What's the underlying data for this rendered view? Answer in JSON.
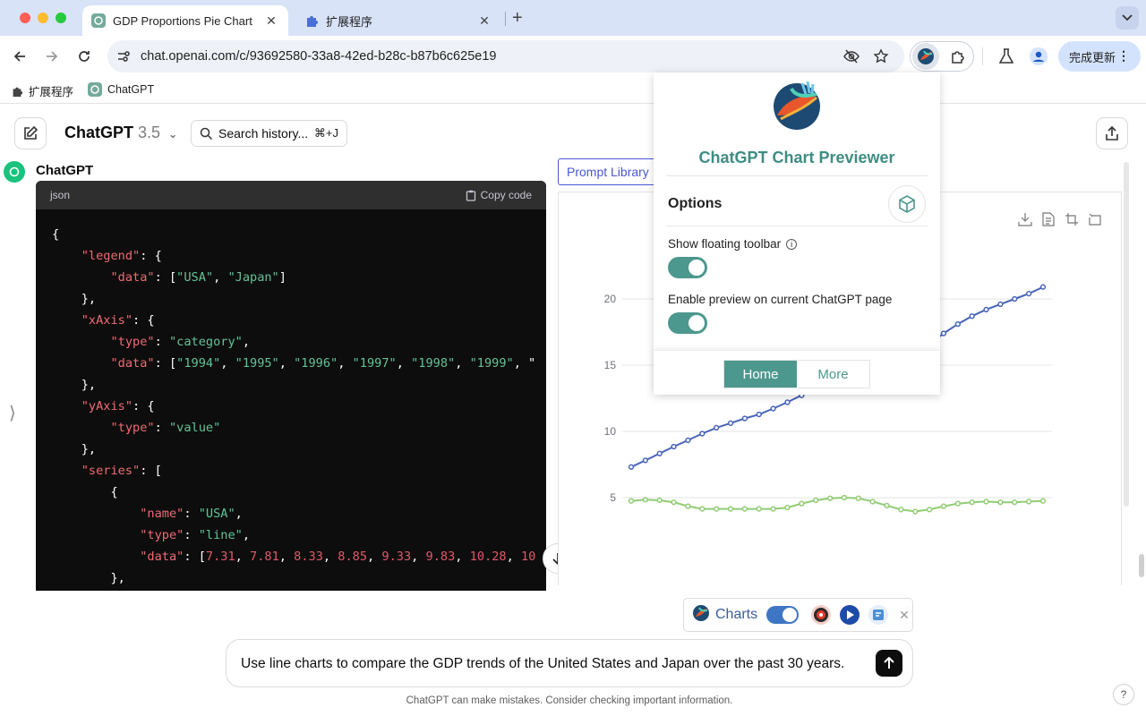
{
  "browser": {
    "tabs": [
      {
        "title": "GDP Proportions Pie Chart",
        "active": true
      },
      {
        "title": "扩展程序",
        "active": false
      }
    ],
    "url": "chat.openai.com/c/93692580-33a8-42ed-b28c-b87b6c625e19",
    "update_label": "完成更新",
    "bookmarks": [
      {
        "label": "扩展程序",
        "icon": "puzzle-icon"
      },
      {
        "label": "ChatGPT",
        "icon": "chatgpt-icon"
      }
    ]
  },
  "chat": {
    "model": "ChatGPT",
    "model_version": "3.5",
    "search_placeholder": "Search history...",
    "search_shortcut": "⌘+J",
    "bot_name": "ChatGPT",
    "code": {
      "lang": "json",
      "copy_label": "Copy code",
      "lines": [
        "{",
        "    \"legend\": {",
        "        \"data\": [\"USA\", \"Japan\"]",
        "    },",
        "    \"xAxis\": {",
        "        \"type\": \"category\",",
        "        \"data\": [\"1994\", \"1995\", \"1996\", \"1997\", \"1998\", \"1999\", \"",
        "    },",
        "    \"yAxis\": {",
        "        \"type\": \"value\"",
        "    },",
        "    \"series\": [",
        "        {",
        "            \"name\": \"USA\",",
        "            \"type\": \"line\",",
        "            \"data\": [7.31, 7.81, 8.33, 8.85, 9.33, 9.83, 10.28, 10",
        "        },"
      ]
    },
    "composer_text": "Use line charts to compare the GDP trends of the United States and Japan over the past 30 years.",
    "disclaimer": "ChatGPT can make mistakes. Consider checking important information.",
    "help": "?"
  },
  "preview": {
    "prompt_library": "Prompt Library",
    "floating_toolbar_label": "Charts"
  },
  "popup": {
    "title": "ChatGPT Chart Previewer",
    "options_heading": "Options",
    "option_1": "Show floating toolbar",
    "option_2": "Enable preview on current ChatGPT page",
    "option_1_on": true,
    "option_2_on": true,
    "tab_home": "Home",
    "tab_more": "More"
  },
  "chart_data": {
    "type": "line",
    "ylim": [
      0,
      25
    ],
    "yticks": [
      5,
      10,
      15,
      20,
      25
    ],
    "series": [
      {
        "name": "USA",
        "color": "#4964b8",
        "values": [
          7.31,
          7.81,
          8.33,
          8.85,
          9.33,
          9.83,
          10.28,
          10.62,
          10.98,
          11.28,
          11.72,
          12.2,
          12.72,
          13.25,
          13.45,
          13.3,
          14.2,
          14.6,
          15.0,
          15.5,
          16.0,
          16.6,
          17.4,
          18.1,
          18.7,
          19.2,
          19.6,
          20.0,
          20.4,
          20.9
        ]
      },
      {
        "name": "Japan",
        "color": "#91cc75",
        "values": [
          4.75,
          4.85,
          4.8,
          4.65,
          4.35,
          4.15,
          4.15,
          4.15,
          4.15,
          4.15,
          4.15,
          4.25,
          4.55,
          4.8,
          4.95,
          5.0,
          4.95,
          4.7,
          4.4,
          4.1,
          3.95,
          4.1,
          4.35,
          4.55,
          4.65,
          4.7,
          4.65,
          4.65,
          4.7,
          4.75
        ]
      }
    ]
  },
  "colors": {
    "accent": "#4d988e",
    "chart_blue": "#4964b8",
    "chart_green": "#91cc75"
  }
}
